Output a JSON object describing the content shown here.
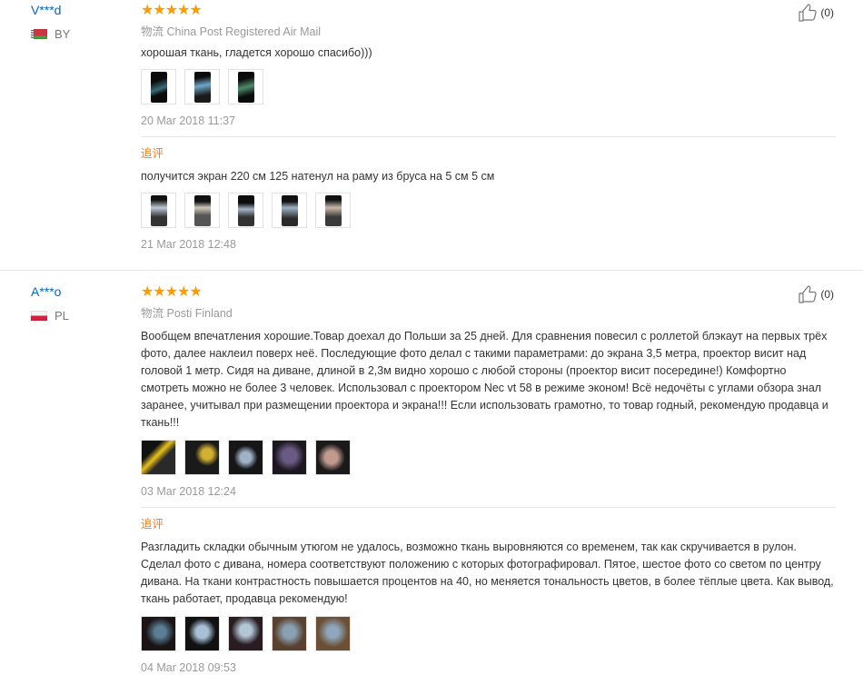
{
  "reviews": [
    {
      "user": "V***d",
      "country": "BY",
      "stars": "★★★★★",
      "shipping_label": "物流",
      "shipping": "China Post Registered Air Mail",
      "helpful": "(0)",
      "text": "хорошая ткань, гладется хорошо спасибо)))",
      "date": "20 Mar 2018 11:37",
      "followup_tag": "追评",
      "followup_text": "получится экран 220 см 125 натенул на раму из бруса на 5 см 5 см",
      "followup_date": "21 Mar 2018 12:48"
    },
    {
      "user": "A***o",
      "country": "PL",
      "stars": "★★★★★",
      "shipping_label": "物流",
      "shipping": "Posti Finland",
      "helpful": "(0)",
      "text": "Вообщем впечатления хорошие.Товар доехал до Польши за 25 дней. Для сравнения повесил с роллетой блэкаут на первых трёх фото, далее наклеил поверх неё. Последующие фото делал с такими параметрами: до экрана 3,5 метра, проектор висит над головой 1 метр. Сидя на диване, длиной в 2,3м видно хорошо с любой стороны (проектор висит посередине!) Комфортно смотреть можно не более 3 человек. Использовал с проектором Nec vt 58 в режиме эконом! Всё недочёты с углами обзора знал заранее, учитывал при размещении проектора и экрана!!! Если использовать грамотно, то товар годный, рекомендую продавца и ткань!!!",
      "date": "03 Mar 2018 12:24",
      "followup_tag": "追评",
      "followup_text": "Разгладить складки обычным утюгом не удалось, возможно ткань выровняются со временем, так как скручивается в рулон. Сделал фото с дивана, номера соответствуют положению с которых фотографировал. Пятое, шестое фото со светом по центру дивана. На ткани контрастность повышается процентов на 40, но меняется тональность цветов, в более тёплые цвета. Как вывод, ткань работает, продавца рекомендую!",
      "followup_date": "04 Mar 2018 09:53"
    }
  ]
}
